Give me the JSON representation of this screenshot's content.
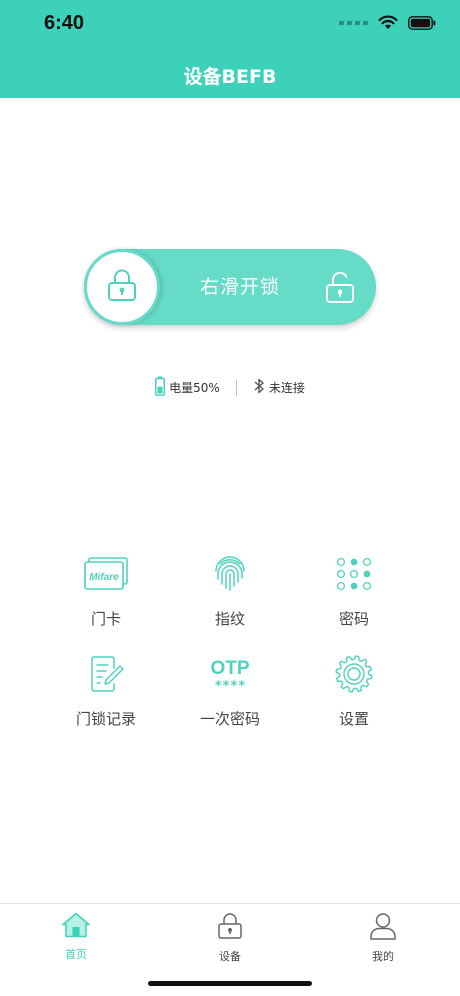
{
  "status_bar": {
    "time": "6:40"
  },
  "header": {
    "title": "设备BEFB"
  },
  "unlock_slider": {
    "label": "右滑开锁"
  },
  "info": {
    "battery_text": "电量50%",
    "battery_level": 0.5,
    "bluetooth_text": "未连接"
  },
  "menu": {
    "items": [
      {
        "label": "门卡",
        "icon": "mifare-card-icon",
        "card_text": "Mifare"
      },
      {
        "label": "指纹",
        "icon": "fingerprint-icon"
      },
      {
        "label": "密码",
        "icon": "keypad-icon"
      },
      {
        "label": "门锁记录",
        "icon": "record-icon"
      },
      {
        "label": "一次密码",
        "icon": "otp-icon",
        "otp_text": "OTP",
        "otp_mask": "****"
      },
      {
        "label": "设置",
        "icon": "gear-icon"
      }
    ]
  },
  "tabbar": {
    "tabs": [
      {
        "label": "首页",
        "icon": "home-icon",
        "active": true
      },
      {
        "label": "设备",
        "icon": "lock-icon",
        "active": false
      },
      {
        "label": "我的",
        "icon": "user-icon",
        "active": false
      }
    ]
  },
  "colors": {
    "accent": "#3dd1b9",
    "slider": "#66dbc8"
  }
}
